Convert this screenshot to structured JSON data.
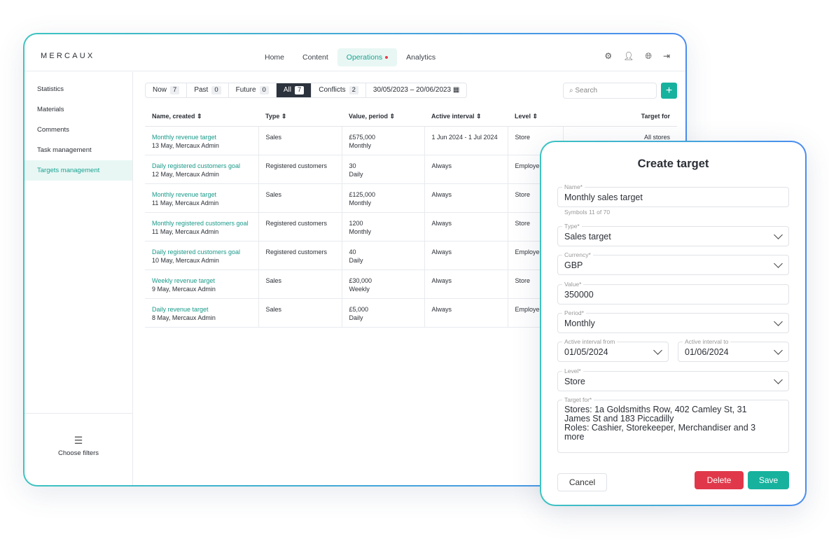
{
  "app": {
    "logo": "MERCAUX",
    "nav": [
      {
        "label": "Home"
      },
      {
        "label": "Content"
      },
      {
        "label": "Operations"
      },
      {
        "label": "Analytics"
      }
    ],
    "header_icons": [
      "gear-icon",
      "user-icon",
      "globe-icon",
      "logout-icon"
    ],
    "sidebar": {
      "items": [
        {
          "label": "Statistics"
        },
        {
          "label": "Materials"
        },
        {
          "label": "Comments"
        },
        {
          "label": "Task management"
        },
        {
          "label": "Targets management"
        }
      ],
      "filters_label": "Choose filters"
    },
    "segments": [
      {
        "label": "Now",
        "count": "7"
      },
      {
        "label": "Past",
        "count": "0"
      },
      {
        "label": "Future",
        "count": "0"
      },
      {
        "label": "All",
        "count": "7"
      },
      {
        "label": "Conflicts",
        "count": "2"
      }
    ],
    "date_range": "30/05/2023 – 20/06/2023",
    "search_placeholder": "Search",
    "table": {
      "headers": [
        "Name, created ⇕",
        "Type ⇕",
        "Value, period ⇕",
        "Active interval ⇕",
        "Level ⇕",
        "Target for"
      ],
      "rows": [
        {
          "name": "Monthly revenue target",
          "created": "13 May, Mercaux Admin",
          "type": "Sales",
          "value": "£575,000",
          "period": "Monthly",
          "interval": "1 Jun 2024 - 1 Jul 2024",
          "level": "Store",
          "target": "All stores"
        },
        {
          "name": "Daily registered customers goal",
          "created": "12 May, Mercaux Admin",
          "type": "Registered customers",
          "value": "30",
          "period": "Daily",
          "interval": "Always",
          "level": "Employee",
          "target": ""
        },
        {
          "name": "Monthly revenue target",
          "created": "11 May, Mercaux Admin",
          "type": "Sales",
          "value": "£125,000",
          "period": "Monthly",
          "interval": "Always",
          "level": "Store",
          "target": ""
        },
        {
          "name": "Monthly registered customers goal",
          "created": "11 May, Mercaux Admin",
          "type": "Registered customers",
          "value": "1200",
          "period": "Monthly",
          "interval": "Always",
          "level": "Store",
          "target": ""
        },
        {
          "name": "Daily registered customers goal",
          "created": "10 May, Mercaux Admin",
          "type": "Registered customers",
          "value": "40",
          "period": "Daily",
          "interval": "Always",
          "level": "Employee",
          "target": ""
        },
        {
          "name": "Weekly revenue target",
          "created": "9 May, Mercaux Admin",
          "type": "Sales",
          "value": "£30,000",
          "period": "Weekly",
          "interval": "Always",
          "level": "Store",
          "target": ""
        },
        {
          "name": "Daily revenue target",
          "created": "8 May, Mercaux Admin",
          "type": "Sales",
          "value": "£5,000",
          "period": "Daily",
          "interval": "Always",
          "level": "Employee",
          "target": ""
        }
      ]
    }
  },
  "modal": {
    "title": "Create target",
    "name": {
      "label": "Name*",
      "value": "Monthly sales target",
      "hint": "Symbols 11 of 70"
    },
    "type": {
      "label": "Type*",
      "value": "Sales target"
    },
    "currency": {
      "label": "Currency*",
      "value": "GBP"
    },
    "value": {
      "label": "Value*",
      "value": "350000"
    },
    "period": {
      "label": "Period*",
      "value": "Monthly"
    },
    "from": {
      "label": "Active interval from",
      "value": "01/05/2024"
    },
    "to": {
      "label": "Active interval to",
      "value": "01/06/2024"
    },
    "level": {
      "label": "Level*",
      "value": "Store"
    },
    "target_for": {
      "label": "Target for*",
      "value": "Stores: 1a Goldsmiths Row, 402 Camley St, 31 James St and 183 Piccadilly\nRoles: Cashier, Storekeeper, Merchandiser and 3 more"
    },
    "cancel": "Cancel",
    "delete": "Delete",
    "save": "Save",
    "colors": {
      "accent": "#17b29e",
      "danger": "#e0384a"
    }
  }
}
